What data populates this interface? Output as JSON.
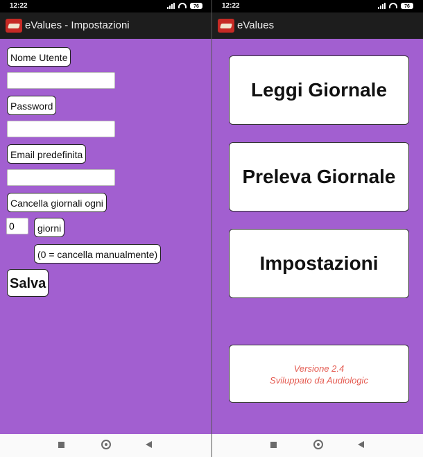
{
  "status": {
    "time": "12:22",
    "battery": "76"
  },
  "settings_screen": {
    "title": "eValues - Impostazioni",
    "username_label": "Nome Utente",
    "username_value": "",
    "password_label": "Password",
    "password_value": "",
    "email_label": "Email predefinita",
    "email_value": "",
    "delete_label": "Cancella giornali ogni",
    "delete_days_value": "0",
    "days_label": "giorni",
    "hint": "(0 = cancella manualmente)",
    "save_label": "Salva"
  },
  "main_screen": {
    "title": "eValues",
    "buttons": [
      "Leggi Giornale",
      "Preleva Giornale",
      "Impostazioni"
    ],
    "version": "Versione 2.4",
    "developer": "Sviluppato da Audiologic"
  },
  "icons": {
    "signal": "signal-icon",
    "wifi": "wifi-icon",
    "battery": "battery-icon",
    "app_logo": "app-logo-icon",
    "recent": "recent-apps-icon",
    "home": "home-icon",
    "back": "back-icon"
  },
  "colors": {
    "background": "#a25fd0",
    "app_bar": "#1d1d1d",
    "status_bar": "#000000",
    "version_text": "#e45a50"
  }
}
